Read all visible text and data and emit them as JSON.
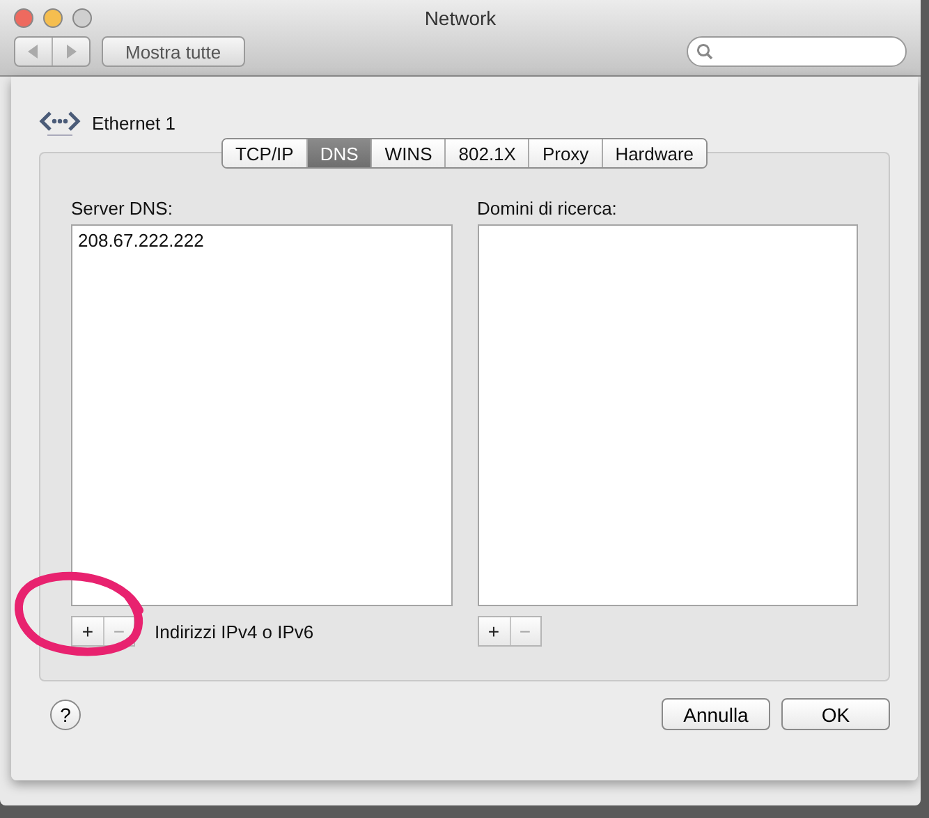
{
  "window": {
    "title": "Network"
  },
  "toolbar": {
    "show_all_button": "Mostra tutte"
  },
  "sheet": {
    "service": "Ethernet 1",
    "tabs": [
      {
        "label": "TCP/IP",
        "selected": false
      },
      {
        "label": "DNS",
        "selected": true
      },
      {
        "label": "WINS",
        "selected": false
      },
      {
        "label": "802.1X",
        "selected": false
      },
      {
        "label": "Proxy",
        "selected": false
      },
      {
        "label": "Hardware",
        "selected": false
      }
    ],
    "lists": [
      {
        "label": "Server DNS:",
        "entries": [
          "208.67.222.222"
        ],
        "add": "+",
        "remove": "−",
        "remove_disabled": true,
        "hint": "Indirizzi IPv4 o IPv6"
      },
      {
        "label": "Domini di ricerca:",
        "add": "+",
        "remove": "−",
        "remove_disabled": true
      }
    ],
    "help_button": "?",
    "buttons": [
      "Annulla",
      "OK"
    ]
  }
}
